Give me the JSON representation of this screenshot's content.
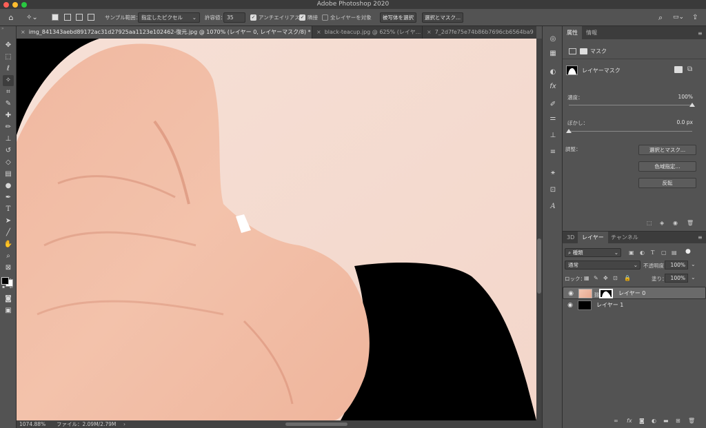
{
  "app": {
    "title": "Adobe Photoshop 2020"
  },
  "colors": {
    "close": "#ff5f57",
    "minimize": "#febc2e",
    "maximize": "#28c840",
    "skin": "#f4dcd2",
    "background_black": "#000000"
  },
  "options_bar": {
    "sample_label": "サンプル範囲：",
    "sample_value": "指定したピクセル",
    "tolerance_label": "許容値：",
    "tolerance_value": "35",
    "antialias_label": "アンチエイリアス",
    "contiguous_label": "隣接",
    "all_layers_label": "全レイヤーを対象",
    "select_subject_label": "被写体を選択",
    "select_mask_label": "選択とマスク..."
  },
  "tabs": [
    {
      "label": "img_841343aebd89172ac31d27925aa1123e102462-復元.jpg @ 1070% (レイヤー 0, レイヤーマスク/8) *"
    },
    {
      "label": "black-teacup.jpg @ 625% (レイヤ..."
    },
    {
      "label": "7_2d7fe75e74b86b7696cb6564ba9"
    }
  ],
  "status": {
    "zoom": "1074.88%",
    "file_info": "ファイル：2.09M/2.79M"
  },
  "properties": {
    "tabs": [
      "属性",
      "情報"
    ],
    "mask_header": "マスク",
    "layer_mask_label": "レイヤーマスク",
    "density_label": "濃度：",
    "density_value": "100%",
    "feather_label": "ぼかし：",
    "feather_value": "0.0 px",
    "refine_label": "調整：",
    "btn_select_mask": "選択とマスク...",
    "btn_color_range": "色域指定...",
    "btn_invert": "反転"
  },
  "layers_panel": {
    "tabs": [
      "3D",
      "レイヤー",
      "チャンネル"
    ],
    "kind_filter": "種類",
    "blend_mode": "通常",
    "opacity_label": "不透明度：",
    "opacity_value": "100%",
    "lock_label": "ロック：",
    "fill_label": "塗り：",
    "fill_value": "100%",
    "layers": [
      {
        "name": "レイヤー 0",
        "selected": true
      },
      {
        "name": "レイヤー 1",
        "selected": false
      }
    ]
  }
}
